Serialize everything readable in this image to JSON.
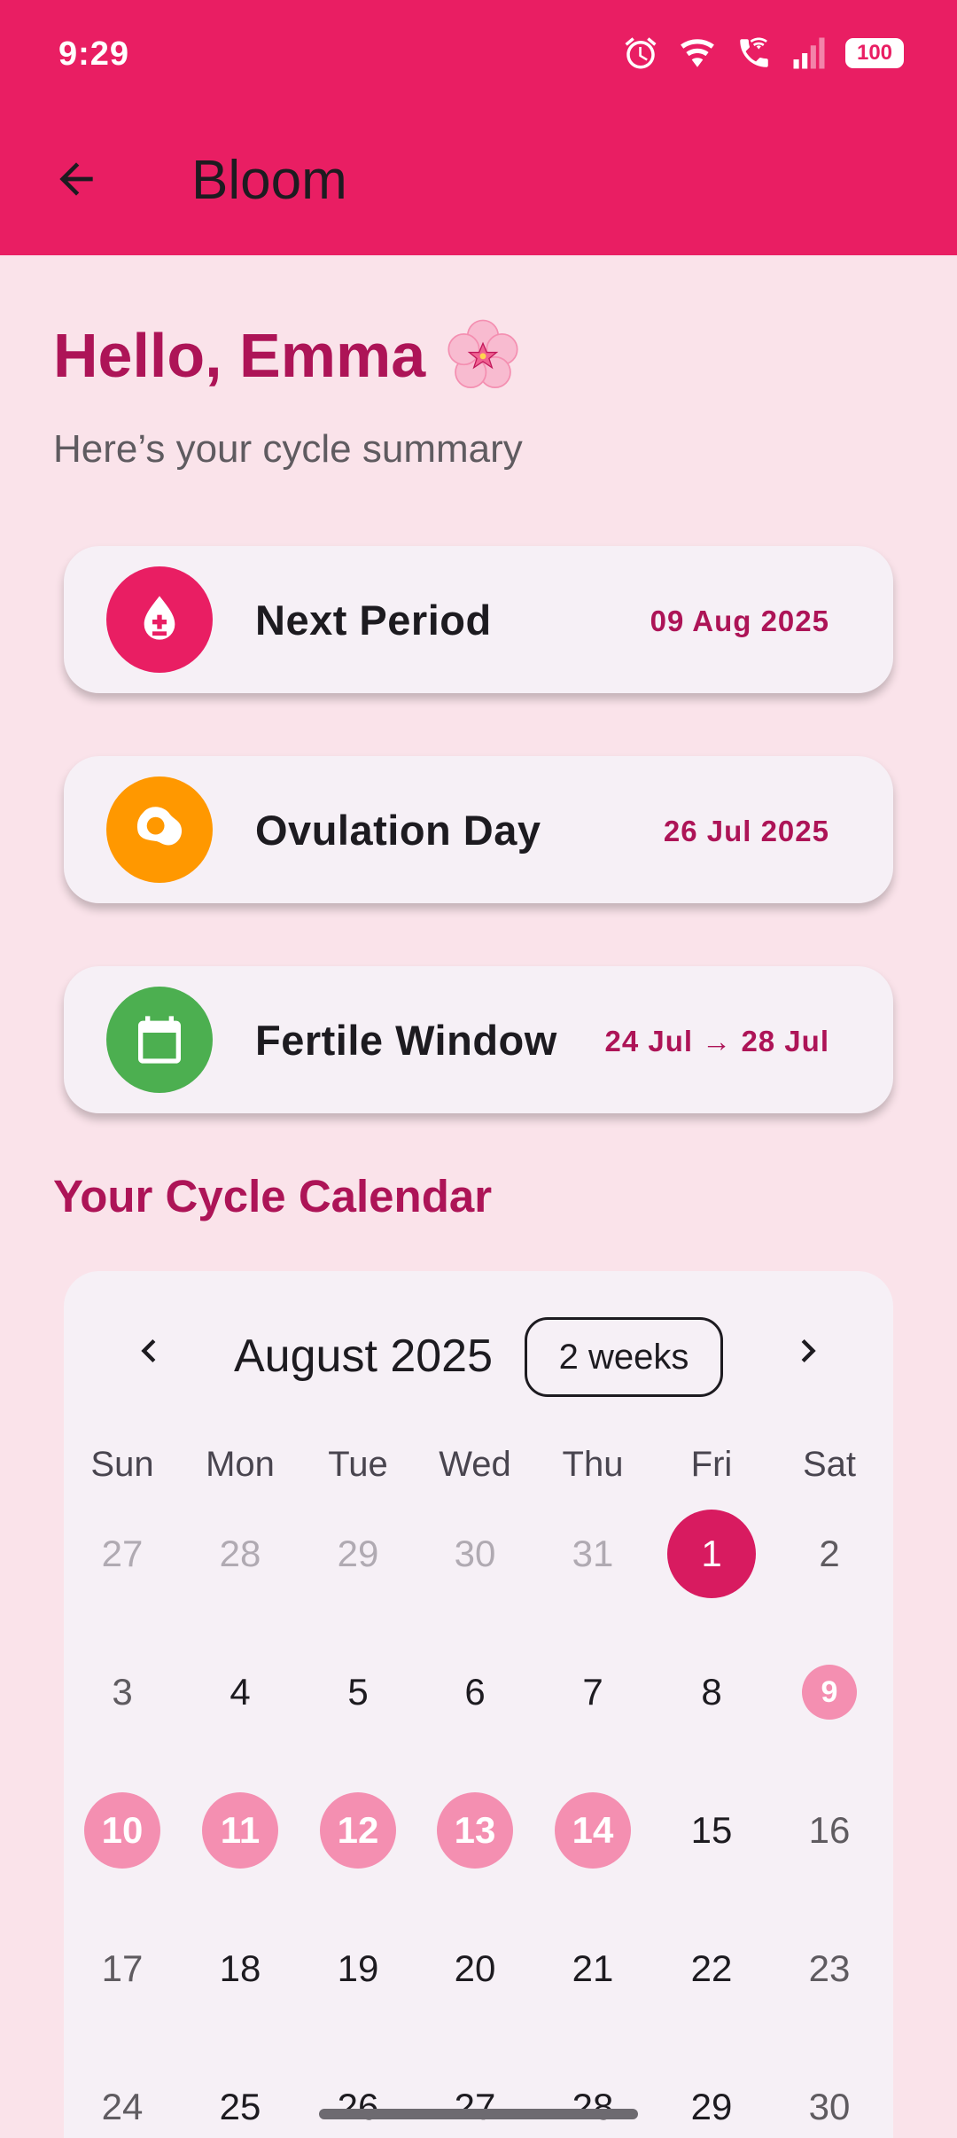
{
  "status_bar": {
    "time": "9:29",
    "battery": "100",
    "icons": [
      "alarm-icon",
      "wifi-icon",
      "wifi-calling-icon",
      "signal-icon",
      "battery-icon"
    ]
  },
  "app_bar": {
    "title": "Bloom",
    "back_icon": "arrow-back-icon",
    "color": "#e91e63"
  },
  "greeting": {
    "title": "Hello, Emma",
    "emoji_icon": "cherry-blossom-icon",
    "subtitle": "Here’s your cycle summary"
  },
  "cards": [
    {
      "label": "Next Period",
      "value": "09 Aug 2025",
      "icon": "blood-drop-icon",
      "color": "#e91e63"
    },
    {
      "label": "Ovulation Day",
      "value": "26 Jul 2025",
      "icon": "egg-icon",
      "color": "#ff9800"
    },
    {
      "label": "Fertile Window",
      "value": "24 Jul → 28 Jul",
      "icon": "calendar-icon",
      "color": "#4caf50"
    }
  ],
  "calendar_section": {
    "title": "Your Cycle Calendar"
  },
  "calendar": {
    "month": "August 2025",
    "format_button": "2 weeks",
    "weekdays": [
      "Sun",
      "Mon",
      "Tue",
      "Wed",
      "Thu",
      "Fri",
      "Sat"
    ],
    "weeks": [
      [
        "27",
        "28",
        "29",
        "30",
        "31",
        "1",
        "2"
      ],
      [
        "3",
        "4",
        "5",
        "6",
        "7",
        "8",
        "9"
      ],
      [
        "10",
        "11",
        "12",
        "13",
        "14",
        "15",
        "16"
      ],
      [
        "17",
        "18",
        "19",
        "20",
        "21",
        "22",
        "23"
      ],
      [
        "24",
        "25",
        "26",
        "27",
        "28",
        "29",
        "30"
      ]
    ],
    "outside_month_days": [
      "27",
      "28",
      "29",
      "30",
      "31"
    ],
    "selected_day": "1",
    "predicted_period_days": [
      "9",
      "10",
      "11",
      "12",
      "13",
      "14"
    ],
    "colors": {
      "selected": "#d81b60",
      "period": "#f48fb1"
    }
  }
}
